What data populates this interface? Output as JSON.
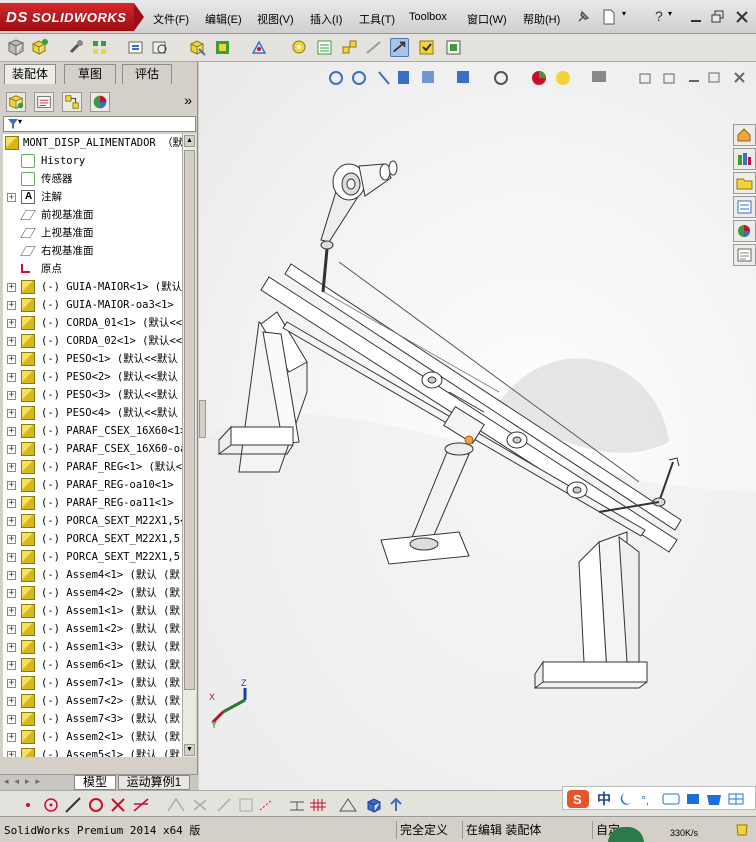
{
  "app": {
    "brand": "SOLIDWORKS",
    "brand_prefix": "DS"
  },
  "menu": {
    "items": [
      "文件(F)",
      "编辑(E)",
      "视图(V)",
      "插入(I)",
      "工具(T)",
      "Toolbox",
      "窗口(W)",
      "帮助(H)"
    ],
    "help_symbol": "?"
  },
  "panel": {
    "tabs": [
      "装配体",
      "草图",
      "评估"
    ],
    "active_tab": "装配体",
    "expand_symbol": "»"
  },
  "tree": {
    "root": "MONT_DISP_ALIMENTADOR （默认",
    "items": [
      {
        "label": "History",
        "icon": "history-icon",
        "mono": true
      },
      {
        "label": "传感器",
        "icon": "sensor-icon"
      },
      {
        "label": "注解",
        "icon": "annotation-icon",
        "expand": true
      },
      {
        "label": "前视基准面",
        "icon": "plane-icon"
      },
      {
        "label": "上视基准面",
        "icon": "plane-icon"
      },
      {
        "label": "右视基准面",
        "icon": "plane-icon"
      },
      {
        "label": "原点",
        "icon": "origin-icon"
      },
      {
        "label": "(-) GUIA-MAIOR<1> (默认",
        "icon": "part-icon",
        "expand": true
      },
      {
        "label": "(-) GUIA-MAIOR-oa3<1> (",
        "icon": "part-icon",
        "expand": true
      },
      {
        "label": "(-) CORDA_01<1> (默认<<",
        "icon": "part-icon",
        "expand": true
      },
      {
        "label": "(-) CORDA_02<1> (默认<<",
        "icon": "part-icon",
        "expand": true
      },
      {
        "label": "(-) PESO<1> (默认<<默认",
        "icon": "part-icon",
        "expand": true
      },
      {
        "label": "(-) PESO<2> (默认<<默认",
        "icon": "part-icon",
        "expand": true
      },
      {
        "label": "(-) PESO<3> (默认<<默认",
        "icon": "part-icon",
        "expand": true
      },
      {
        "label": "(-) PESO<4> (默认<<默认",
        "icon": "part-icon",
        "expand": true
      },
      {
        "label": "(-) PARAF_CSEX_16X60<1>",
        "icon": "part-icon",
        "expand": true
      },
      {
        "label": "(-) PARAF_CSEX_16X60-oa",
        "icon": "part-icon",
        "expand": true
      },
      {
        "label": "(-) PARAF_REG<1> (默认<",
        "icon": "part-icon",
        "expand": true
      },
      {
        "label": "(-) PARAF_REG-oa10<1> (",
        "icon": "part-icon",
        "expand": true
      },
      {
        "label": "(-) PARAF_REG-oa11<1> (",
        "icon": "part-icon",
        "expand": true
      },
      {
        "label": "(-) PORCA_SEXT_M22X1,5<",
        "icon": "part-icon",
        "expand": true
      },
      {
        "label": "(-) PORCA_SEXT_M22X1,5-",
        "icon": "part-icon",
        "expand": true
      },
      {
        "label": "(-) PORCA_SEXT_M22X1,5-",
        "icon": "part-icon",
        "expand": true
      },
      {
        "label": "(-) Assem4<1> (默认 (默",
        "icon": "asm-icon",
        "expand": true
      },
      {
        "label": "(-) Assem4<2> (默认 (默",
        "icon": "asm-icon",
        "expand": true
      },
      {
        "label": "(-) Assem1<1> (默认 (默",
        "icon": "asm-icon",
        "expand": true
      },
      {
        "label": "(-) Assem1<2> (默认 (默",
        "icon": "asm-icon",
        "expand": true
      },
      {
        "label": "(-) Assem1<3> (默认 (默",
        "icon": "asm-icon",
        "expand": true
      },
      {
        "label": "(-) Assem6<1> (默认 (默",
        "icon": "asm-icon",
        "expand": true
      },
      {
        "label": "(-) Assem7<1> (默认 (默",
        "icon": "asm-icon",
        "expand": true
      },
      {
        "label": "(-) Assem7<2> (默认 (默",
        "icon": "asm-icon",
        "expand": true
      },
      {
        "label": "(-) Assem7<3> (默认 (默",
        "icon": "asm-icon",
        "expand": true
      },
      {
        "label": "(-) Assem2<1> (默认 (默",
        "icon": "asm-icon",
        "expand": true
      },
      {
        "label": "(-) Assem5<1> (默认 (默",
        "icon": "asm-icon",
        "expand": true
      }
    ]
  },
  "bottom_tabs": [
    "模型",
    "运动算例1"
  ],
  "status": {
    "app_version": "SolidWorks Premium 2014 x64 版",
    "definition": "完全定义",
    "mode": "在编辑 装配体",
    "custom": "自定",
    "speed": "330K/s"
  },
  "ime": {
    "label": "中"
  },
  "colors": {
    "accent": "#c8102e",
    "part_yellow": "#f2d43a",
    "viewport_bg": "#f4f4f4"
  }
}
